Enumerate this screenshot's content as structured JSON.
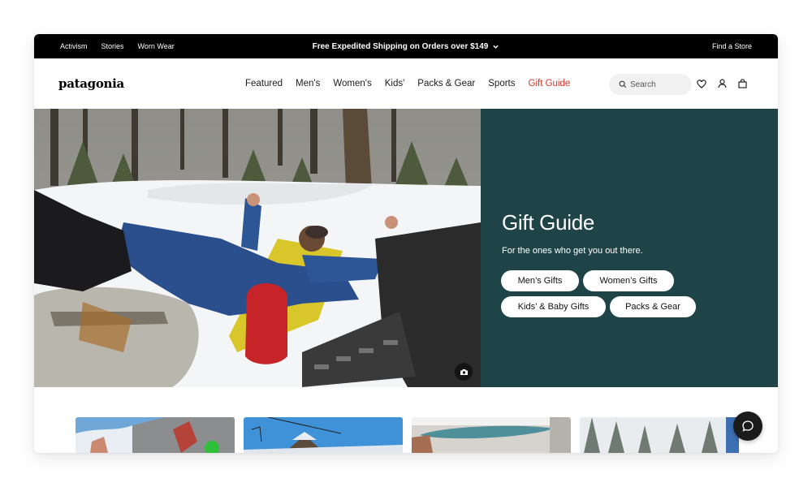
{
  "topbar": {
    "links": [
      "Activism",
      "Stories",
      "Worn Wear"
    ],
    "promo": "Free Expedited Shipping on Orders over $149",
    "store_link": "Find a Store"
  },
  "header": {
    "logo": "patagonia",
    "nav": [
      "Featured",
      "Men's",
      "Women's",
      "Kids'",
      "Packs & Gear",
      "Sports",
      "Gift Guide"
    ],
    "search_placeholder": "Search",
    "icons": [
      "heart-icon",
      "account-icon",
      "bag-icon"
    ]
  },
  "hero": {
    "title": "Gift Guide",
    "subtitle": "For the ones who get you out there.",
    "buttons": [
      "Men’s Gifts",
      "Women’s Gifts",
      "Kids’ & Baby Gifts",
      "Packs & Gear"
    ],
    "panel_color": "#1f4447"
  },
  "colors": {
    "accent": "#d8322b",
    "topbar": "#000000"
  }
}
